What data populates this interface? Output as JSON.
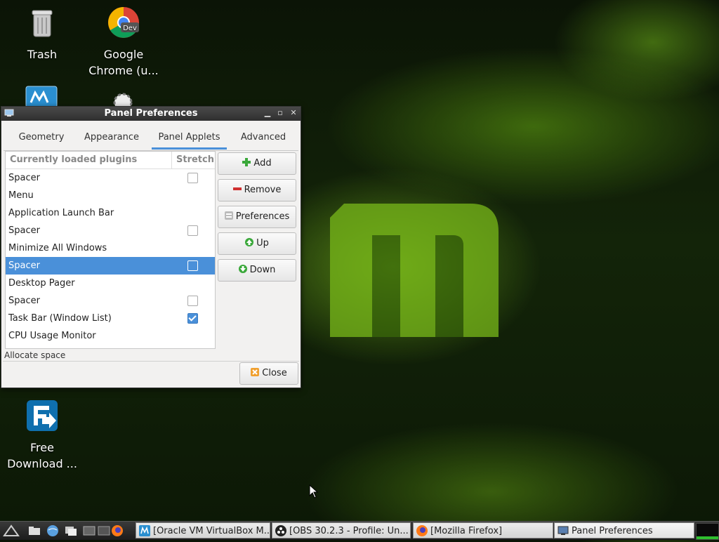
{
  "desktop": {
    "icons": [
      {
        "label": "Trash",
        "icon": "trash-icon"
      },
      {
        "label": "Google Chrome (u...",
        "icon": "chrome-dev-icon",
        "badge": "Dev"
      },
      {
        "label": "Free Download ...",
        "icon": "free-download-manager-icon"
      }
    ]
  },
  "window": {
    "title": "Panel Preferences",
    "tabs": [
      "Geometry",
      "Appearance",
      "Panel Applets",
      "Advanced"
    ],
    "active_tab": "Panel Applets",
    "list": {
      "headers": [
        "Currently loaded plugins",
        "Stretch"
      ],
      "rows": [
        {
          "name": "Spacer",
          "stretch": "unchecked"
        },
        {
          "name": "Menu",
          "stretch": "none"
        },
        {
          "name": "Application Launch Bar",
          "stretch": "none"
        },
        {
          "name": "Spacer",
          "stretch": "unchecked"
        },
        {
          "name": "Minimize All Windows",
          "stretch": "none"
        },
        {
          "name": "Spacer",
          "stretch": "unchecked",
          "selected": true
        },
        {
          "name": "Desktop Pager",
          "stretch": "none"
        },
        {
          "name": "Spacer",
          "stretch": "unchecked"
        },
        {
          "name": "Task Bar (Window List)",
          "stretch": "checked"
        },
        {
          "name": "CPU Usage Monitor",
          "stretch": "none"
        }
      ]
    },
    "buttons": {
      "add": "Add",
      "remove": "Remove",
      "preferences": "Preferences",
      "up": "Up",
      "down": "Down",
      "close": "Close"
    },
    "status": "Allocate space"
  },
  "taskbar": {
    "tasks": [
      {
        "label": "[Oracle VM VirtualBox M...",
        "icon": "virtualbox-icon"
      },
      {
        "label": "[OBS 30.2.3 - Profile: Un...",
        "icon": "obs-icon"
      },
      {
        "label": "[Mozilla Firefox]",
        "icon": "firefox-icon"
      },
      {
        "label": "Panel Preferences",
        "icon": "panel-prefs-icon"
      }
    ]
  },
  "colors": {
    "selection": "#4a90d9",
    "accent_green": "#7cc520"
  }
}
